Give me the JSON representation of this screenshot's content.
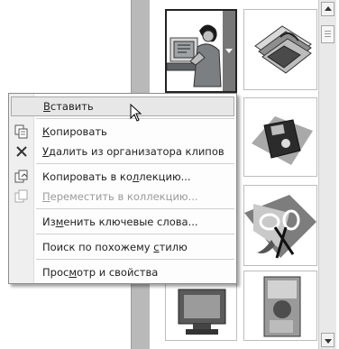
{
  "context_menu": {
    "items": [
      {
        "label": "Вставить",
        "mnemonic_index": 0,
        "highlighted": true,
        "disabled": false,
        "icon": null
      },
      {
        "label": "Копировать",
        "mnemonic_index": 0,
        "highlighted": false,
        "disabled": false,
        "icon": "copy-icon"
      },
      {
        "label": "Удалить из организатора клипов",
        "mnemonic_index": 0,
        "highlighted": false,
        "disabled": false,
        "icon": "delete-x-icon"
      },
      {
        "label": "Копировать в коллекцию...",
        "mnemonic_index": 15,
        "highlighted": false,
        "disabled": false,
        "icon": "copy-to-collection-icon"
      },
      {
        "label": "Переместить в коллекцию...",
        "mnemonic_index": 0,
        "highlighted": false,
        "disabled": true,
        "icon": "move-to-collection-icon"
      },
      {
        "label": "Изменить ключевые слова...",
        "mnemonic_index": 2,
        "highlighted": false,
        "disabled": false,
        "icon": null
      },
      {
        "label": "Поиск по похожему стилю",
        "mnemonic_index": 18,
        "highlighted": false,
        "disabled": false,
        "icon": null
      },
      {
        "label": "Просмотр и свойства",
        "mnemonic_index": 4,
        "highlighted": false,
        "disabled": false,
        "icon": null
      }
    ]
  },
  "gallery": {
    "thumbnails": [
      {
        "name": "person-at-computer-clipart",
        "selected": true
      },
      {
        "name": "documents-disk-clipart",
        "selected": false
      },
      {
        "name": "floppy-disk-clipart",
        "selected": false
      },
      {
        "name": "scissors-clipart",
        "selected": false
      },
      {
        "name": "monitor-clipart",
        "selected": false
      },
      {
        "name": "collage-clipart",
        "selected": false
      }
    ]
  },
  "colors": {
    "menu_highlight": "#e7e7e7",
    "disabled_text": "#9a9a9a",
    "divider": "#b9b9b9"
  }
}
